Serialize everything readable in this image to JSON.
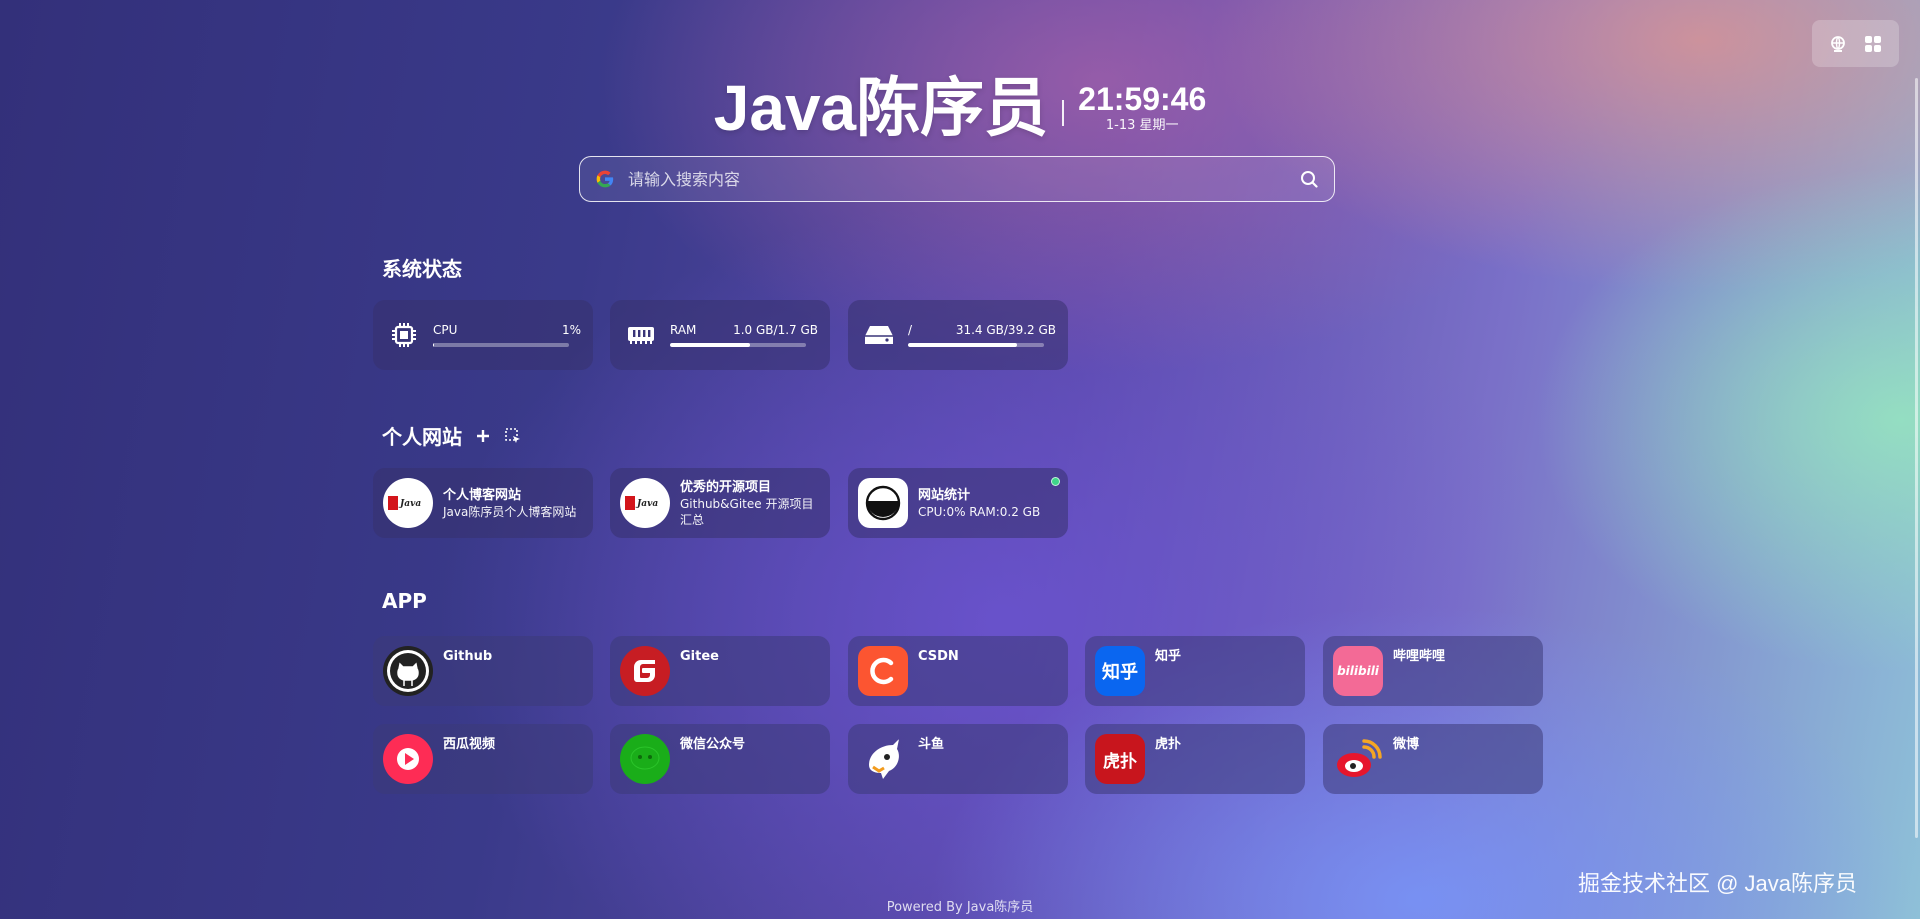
{
  "header": {
    "site_title": "Java陈序员",
    "separator": "|",
    "time": "21:59:46",
    "date": "1-13 星期一"
  },
  "top_tools": {
    "icons": [
      "globe-icon",
      "apps-grid-icon"
    ]
  },
  "search": {
    "placeholder": "请输入搜索内容",
    "engine_icon": "google-icon"
  },
  "sections": {
    "status_title": "系统状态",
    "sites_title": "个人网站",
    "apps_title": "APP"
  },
  "system_status": [
    {
      "label": "CPU",
      "value": "1%",
      "usage": 0.01,
      "icon": "cpu-icon"
    },
    {
      "label": "RAM",
      "value": "1.0 GB/1.7 GB",
      "usage": 0.59,
      "icon": "ram-icon"
    },
    {
      "label": "/",
      "value": "31.4 GB/39.2 GB",
      "usage": 0.8,
      "icon": "disk-icon"
    }
  ],
  "sites": [
    {
      "name": "个人博客网站",
      "desc": "Java陈序员个人博客网站",
      "logo": "Java"
    },
    {
      "name": "优秀的开源项目",
      "desc": "Github&Gitee 开源项目汇总",
      "logo": "Java"
    },
    {
      "name": "网站统计",
      "desc": "CPU:0% RAM:0.2 GB",
      "status": "online"
    }
  ],
  "apps": [
    {
      "name": "Github",
      "icon": "github-icon"
    },
    {
      "name": "Gitee",
      "icon": "gitee-icon"
    },
    {
      "name": "CSDN",
      "icon": "csdn-icon"
    },
    {
      "name": "知乎",
      "icon": "zhihu-icon",
      "icon_text": "知乎"
    },
    {
      "name": "哔哩哔哩",
      "icon": "bilibili-icon",
      "icon_text": "bilibili"
    },
    {
      "name": "西瓜视频",
      "icon": "xigua-icon"
    },
    {
      "name": "微信公众号",
      "icon": "wechat-icon"
    },
    {
      "name": "斗鱼",
      "icon": "douyu-icon"
    },
    {
      "name": "虎扑",
      "icon": "hupu-icon",
      "icon_text": "虎扑"
    },
    {
      "name": "微博",
      "icon": "weibo-icon"
    }
  ],
  "colors": {
    "csdn": "#fc5531",
    "gitee": "#c71d23",
    "zhihu": "#0a66f0",
    "bilibili": "#f36a96",
    "xigua": "#fe2c55",
    "wechat": "#1aad19",
    "hupu": "#c8151d",
    "status_online": "#3fd58a"
  },
  "footer": {
    "text": "Powered By Java陈序员"
  },
  "watermark": {
    "text": "掘金技术社区 @ Java陈序员"
  }
}
